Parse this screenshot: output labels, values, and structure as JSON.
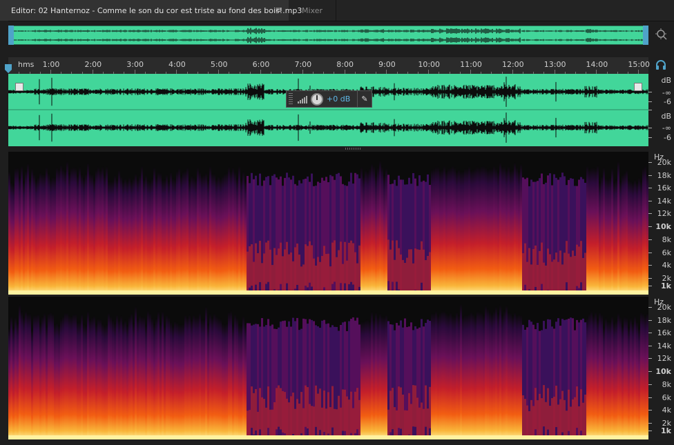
{
  "tabs": {
    "editor_label": "Editor: 02 Hanternoz - Comme le son du cor est triste au fond des bois!.mp3",
    "menu_icon": "≡",
    "mixer_label": "Mixer"
  },
  "ruler": {
    "unit": "hms",
    "ticks": [
      "1:00",
      "2:00",
      "3:00",
      "4:00",
      "5:00",
      "6:00",
      "7:00",
      "8:00",
      "9:00",
      "10:00",
      "11:00",
      "12:00",
      "13:00",
      "14:00",
      "15:00"
    ]
  },
  "hud": {
    "value": "+0 dB",
    "pin_icon": "✎"
  },
  "db_scale": {
    "unit": "dB",
    "labels": [
      "-∞",
      "-6"
    ]
  },
  "freq_scale": {
    "unit": "Hz",
    "labels": [
      "20k",
      "18k",
      "16k",
      "14k",
      "12k",
      "10k",
      "8k",
      "6k",
      "4k",
      "2k",
      "1k"
    ]
  },
  "colors": {
    "waveform_bg": "#42d69a",
    "waveform_fg": "#0c0c0c",
    "accent": "#4fa3c9"
  },
  "icons": [
    "zoom-icon",
    "headphone-icon",
    "playhead-marker",
    "fade-in-handle",
    "fade-out-handle",
    "pin-icon",
    "level-icon",
    "volume-knob"
  ]
}
